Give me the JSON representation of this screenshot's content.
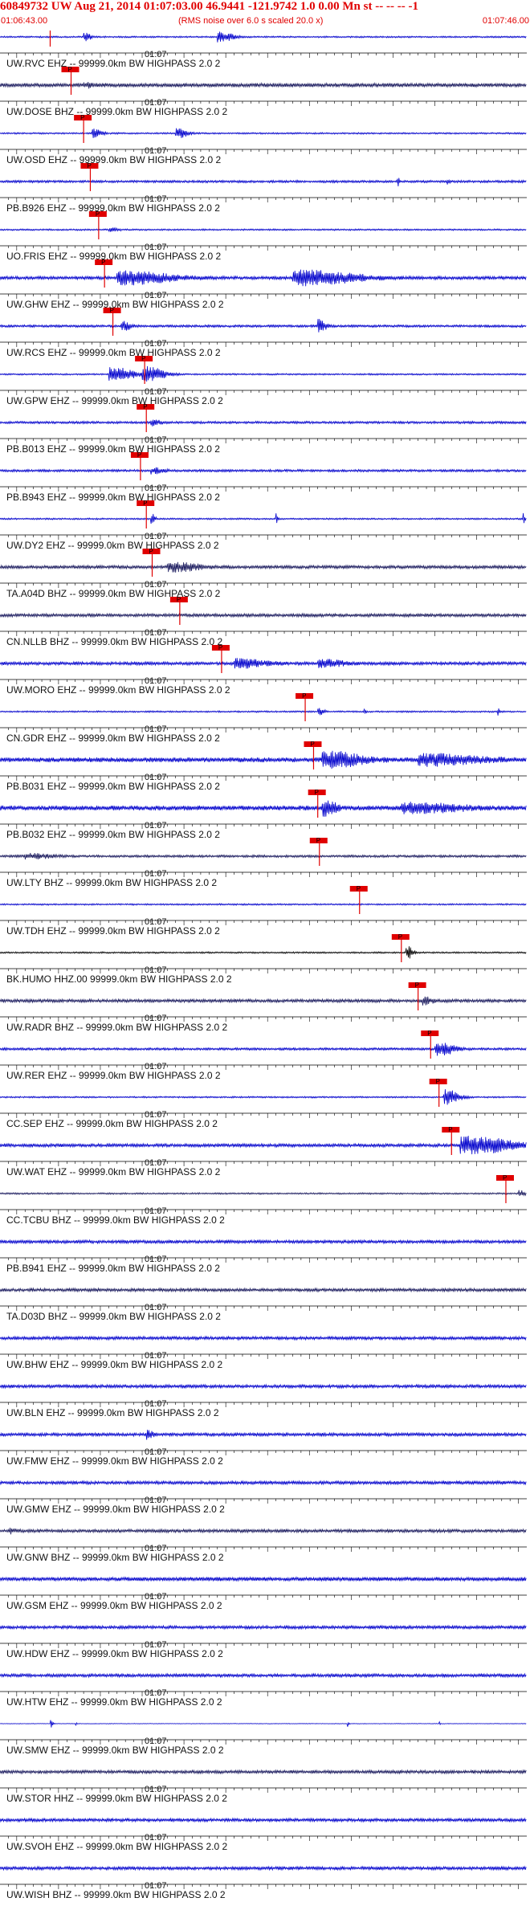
{
  "header": {
    "title": "60849732 UW Aug 21, 2014 01:07:03.00   46.9441 -121.9742  1.0 0.00 Mn st -- -- --  -1",
    "start_time": "01:06:43.00",
    "note": "(RMS noise over 6.0 s scaled 20.0 x)",
    "end_time": "01:07:46.00"
  },
  "colors": {
    "title": "#e00000",
    "trace_blue": "#0000cc",
    "trace_dark": "#1a1a5e",
    "trace_black": "#000000",
    "pick": "#e00000",
    "axis": "#000000"
  },
  "chart_data": {
    "type": "line",
    "title": "60849732 UW Aug 21, 2014 01:07:03.00   46.9441 -121.9742  1.0 0.00 Mn st -- -- --  -1",
    "x_range": [
      "01:06:43.00",
      "01:07:46.00"
    ],
    "x_range_seconds": [
      0,
      63
    ],
    "center_tick_label": "01:07",
    "pick_label": "P",
    "grid": false,
    "legend": "none",
    "series": [
      {
        "name": "UW.RVC EHZ -- 99999.0km BW  HIGHPASS  2.0  2",
        "color": "#0000cc",
        "pick_s": 6.0,
        "noise": 1.0,
        "bursts": [
          [
            10,
            1.2,
            4.5
          ],
          [
            26,
            2.5,
            6.0
          ]
        ]
      },
      {
        "name": "UW.DOSE BHZ -- 99999.0km BW  HIGHPASS  2.0  2",
        "color": "#1a1a5e",
        "pick_s": 8.5,
        "noise": 2.5,
        "bursts": [
          [
            10,
            1.5,
            2.5
          ]
        ]
      },
      {
        "name": "UW.OSD EHZ -- 99999.0km BW  HIGHPASS  2.0  2",
        "color": "#0000cc",
        "pick_s": 10.0,
        "noise": 1.0,
        "bursts": [
          [
            11,
            1.5,
            5.0
          ],
          [
            21,
            2.0,
            5.5
          ]
        ]
      },
      {
        "name": "PB.B926 EHZ -- 99999.0km BW  HIGHPASS  2.0  2",
        "color": "#0000cc",
        "pick_s": 10.8,
        "noise": 1.5,
        "bursts": [
          [
            47.5,
            0.3,
            6.0
          ],
          [
            53.5,
            0.3,
            3.0
          ]
        ]
      },
      {
        "name": "UO.FRIS EHZ -- 99999.0km BW  HIGHPASS  2.0  2",
        "color": "#0000cc",
        "pick_s": 11.8,
        "noise": 1.0,
        "bursts": [
          [
            13,
            1.5,
            2.0
          ]
        ]
      },
      {
        "name": "UW.GHW EHZ -- 99999.0km BW  HIGHPASS  2.0  2",
        "color": "#0000cc",
        "pick_s": 12.5,
        "noise": 2.0,
        "bursts": [
          [
            14,
            8.0,
            8.0
          ],
          [
            35,
            10.0,
            8.5
          ]
        ]
      },
      {
        "name": "UW.RCS EHZ -- 99999.0km BW  HIGHPASS  2.0  2",
        "color": "#0000cc",
        "pick_s": 13.5,
        "noise": 1.5,
        "bursts": [
          [
            14.5,
            1.5,
            5.0
          ],
          [
            38,
            1.2,
            8.0
          ]
        ]
      },
      {
        "name": "UW.GPW EHZ -- 99999.0km BW  HIGHPASS  2.0  2",
        "color": "#0000cc",
        "pick_s": 17.3,
        "noise": 1.0,
        "bursts": [
          [
            13,
            4.0,
            8.5
          ],
          [
            17,
            3.5,
            9.0
          ]
        ]
      },
      {
        "name": "PB.B013 EHZ -- 99999.0km BW  HIGHPASS  2.0  2",
        "color": "#0000cc",
        "pick_s": 17.5,
        "noise": 1.5,
        "bursts": [
          [
            18,
            1.5,
            3.5
          ]
        ]
      },
      {
        "name": "PB.B943 EHZ -- 99999.0km BW  HIGHPASS  2.0  2",
        "color": "#0000cc",
        "pick_s": 16.8,
        "noise": 1.5,
        "bursts": [
          [
            18,
            2.0,
            3.5
          ]
        ]
      },
      {
        "name": "UW.DY2 EHZ -- 99999.0km BW  HIGHPASS  2.0  2",
        "color": "#0000cc",
        "pick_s": 17.5,
        "noise": 1.0,
        "bursts": [
          [
            18,
            0.6,
            9.5
          ],
          [
            33,
            0.3,
            7.0
          ],
          [
            62.5,
            0.3,
            8.0
          ]
        ]
      },
      {
        "name": "TA.A04D BHZ -- 99999.0km BW  HIGHPASS  2.0  2",
        "color": "#1a1a5e",
        "pick_s": 18.2,
        "noise": 2.0,
        "bursts": [
          [
            20,
            5.0,
            5.0
          ]
        ]
      },
      {
        "name": "CN.NLLB BHZ -- 99999.0km BW  HIGHPASS  2.0  2",
        "color": "#1a1a5e",
        "pick_s": 21.5,
        "noise": 2.0,
        "bursts": []
      },
      {
        "name": "UW.MORO EHZ -- 99999.0km BW  HIGHPASS  2.0  2",
        "color": "#0000cc",
        "pick_s": 26.5,
        "noise": 2.0,
        "bursts": [
          [
            28,
            5.0,
            5.0
          ],
          [
            38,
            4.0,
            4.0
          ]
        ]
      },
      {
        "name": "CN.GDR EHZ -- 99999.0km BW  HIGHPASS  2.0  2",
        "color": "#0000cc",
        "pick_s": 36.5,
        "noise": 1.0,
        "bursts": [
          [
            38,
            1.0,
            4.0
          ],
          [
            43.5,
            0.3,
            3.0
          ],
          [
            59.5,
            0.3,
            4.0
          ]
        ]
      },
      {
        "name": "PB.B031 EHZ -- 99999.0km BW  HIGHPASS  2.0  2",
        "color": "#0000cc",
        "pick_s": 37.5,
        "noise": 3.0,
        "bursts": [
          [
            38.5,
            6.0,
            9.0
          ],
          [
            50,
            9.0,
            6.0
          ]
        ]
      },
      {
        "name": "PB.B032 EHZ -- 99999.0km BW  HIGHPASS  2.0  2",
        "color": "#0000cc",
        "pick_s": 38.0,
        "noise": 3.0,
        "bursts": [
          [
            38.5,
            2.0,
            11.0
          ],
          [
            48,
            9.0,
            5.0
          ]
        ]
      },
      {
        "name": "UW.LTY BHZ -- 99999.0km BW  HIGHPASS  2.0  2",
        "color": "#1a1a5e",
        "pick_s": 38.2,
        "noise": 1.5,
        "bursts": [
          [
            3,
            4.0,
            3.0
          ]
        ]
      },
      {
        "name": "UW.TDH EHZ -- 99999.0km BW  HIGHPASS  2.0  2",
        "color": "#0000cc",
        "pick_s": 43.0,
        "noise": 1.0,
        "bursts": []
      },
      {
        "name": "BK.HUMO HHZ.00 99999.0km BW  HIGHPASS  2.0  2",
        "color": "#000000",
        "pick_s": 48.0,
        "noise": 1.0,
        "bursts": [
          [
            48.5,
            1.2,
            8.0
          ]
        ]
      },
      {
        "name": "UW.RADR BHZ -- 99999.0km BW  HIGHPASS  2.0  2",
        "color": "#1a1a5e",
        "pick_s": 50.0,
        "noise": 2.0,
        "bursts": [
          [
            50.5,
            1.5,
            4.0
          ]
        ]
      },
      {
        "name": "UW.RER EHZ -- 99999.0km BW  HIGHPASS  2.0  2",
        "color": "#0000cc",
        "pick_s": 51.5,
        "noise": 1.5,
        "bursts": [
          [
            52,
            3.0,
            9.0
          ]
        ]
      },
      {
        "name": "CC.SEP EHZ -- 99999.0km BW  HIGHPASS  2.0  2",
        "color": "#0000cc",
        "pick_s": 52.5,
        "noise": 1.0,
        "bursts": [
          [
            53,
            2.5,
            9.0
          ]
        ]
      },
      {
        "name": "UW.WAT EHZ -- 99999.0km BW  HIGHPASS  2.0  2",
        "color": "#0000cc",
        "pick_s": 54.0,
        "noise": 2.0,
        "bursts": [
          [
            55,
            8.0,
            11.0
          ]
        ]
      },
      {
        "name": "CC.TCBU BHZ -- 99999.0km BW  HIGHPASS  2.0  2",
        "color": "#1a1a5e",
        "pick_s": 60.5,
        "noise": 1.0,
        "bursts": [
          [
            62,
            1.0,
            4.0
          ]
        ]
      },
      {
        "name": "PB.B941 EHZ -- 99999.0km BW  HIGHPASS  2.0  2",
        "color": "#0000cc",
        "pick_s": null,
        "noise": 2.0,
        "bursts": []
      },
      {
        "name": "TA.D03D BHZ -- 99999.0km BW  HIGHPASS  2.0  2",
        "color": "#1a1a5e",
        "pick_s": null,
        "noise": 2.0,
        "bursts": []
      },
      {
        "name": "UW.BHW EHZ -- 99999.0km BW  HIGHPASS  2.0  2",
        "color": "#0000cc",
        "pick_s": null,
        "noise": 2.0,
        "bursts": []
      },
      {
        "name": "UW.BLN EHZ -- 99999.0km BW  HIGHPASS  2.0  2",
        "color": "#0000cc",
        "pick_s": null,
        "noise": 2.0,
        "bursts": []
      },
      {
        "name": "UW.FMW EHZ -- 99999.0km BW  HIGHPASS  2.0  2",
        "color": "#0000cc",
        "pick_s": null,
        "noise": 2.0,
        "bursts": [
          [
            17.5,
            1.0,
            5.0
          ]
        ]
      },
      {
        "name": "UW.GMW EHZ -- 99999.0km BW  HIGHPASS  2.0  2",
        "color": "#0000cc",
        "pick_s": null,
        "noise": 2.0,
        "bursts": []
      },
      {
        "name": "UW.GNW BHZ -- 99999.0km BW  HIGHPASS  2.0  2",
        "color": "#1a1a5e",
        "pick_s": null,
        "noise": 2.0,
        "bursts": [
          [
            1,
            1.0,
            3.0
          ]
        ]
      },
      {
        "name": "UW.GSM EHZ -- 99999.0km BW  HIGHPASS  2.0  2",
        "color": "#0000cc",
        "pick_s": null,
        "noise": 2.5,
        "bursts": []
      },
      {
        "name": "UW.HDW EHZ -- 99999.0km BW  HIGHPASS  2.0  2",
        "color": "#0000cc",
        "pick_s": null,
        "noise": 2.0,
        "bursts": []
      },
      {
        "name": "UW.HTW EHZ -- 99999.0km BW  HIGHPASS  2.0  2",
        "color": "#0000cc",
        "pick_s": null,
        "noise": 2.0,
        "bursts": []
      },
      {
        "name": "UW.SMW EHZ -- 99999.0km BW  HIGHPASS  2.0  2",
        "color": "#0000cc",
        "pick_s": null,
        "noise": 0.4,
        "bursts": [
          [
            6,
            0.4,
            6.0
          ],
          [
            9,
            0.2,
            3.0
          ],
          [
            41.5,
            0.3,
            4.0
          ],
          [
            52.5,
            0.2,
            3.0
          ]
        ]
      },
      {
        "name": "UW.STOR HHZ -- 99999.0km BW  HIGHPASS  2.0  2",
        "color": "#1a1a5e",
        "pick_s": null,
        "noise": 2.0,
        "bursts": []
      },
      {
        "name": "UW.SVOH EHZ -- 99999.0km BW  HIGHPASS  2.0  2",
        "color": "#0000cc",
        "pick_s": null,
        "noise": 2.0,
        "bursts": []
      },
      {
        "name": "UW.WISH BHZ -- 99999.0km BW  HIGHPASS  2.0  2",
        "color": "#0000cc",
        "pick_s": null,
        "noise": 2.0,
        "bursts": []
      }
    ]
  }
}
